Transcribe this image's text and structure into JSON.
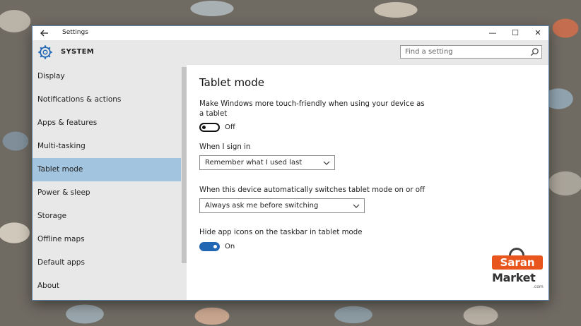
{
  "window": {
    "title": "Settings",
    "back_icon": "back-arrow-icon",
    "controls": {
      "minimize": "—",
      "maximize": "☐",
      "close": "✕"
    }
  },
  "header": {
    "icon": "gear-icon",
    "title": "SYSTEM",
    "search_placeholder": "Find a setting"
  },
  "sidebar": {
    "items": [
      {
        "label": "Display",
        "active": false
      },
      {
        "label": "Notifications & actions",
        "active": false
      },
      {
        "label": "Apps & features",
        "active": false
      },
      {
        "label": "Multi-tasking",
        "active": false
      },
      {
        "label": "Tablet mode",
        "active": true
      },
      {
        "label": "Power & sleep",
        "active": false
      },
      {
        "label": "Storage",
        "active": false
      },
      {
        "label": "Offline maps",
        "active": false
      },
      {
        "label": "Default apps",
        "active": false
      },
      {
        "label": "About",
        "active": false
      }
    ]
  },
  "main": {
    "title": "Tablet mode",
    "touch_friendly": {
      "description": "Make Windows more touch-friendly when using your device as a tablet",
      "state": "Off"
    },
    "sign_in": {
      "label": "When I sign in",
      "selected": "Remember what I used last"
    },
    "auto_switch": {
      "label": "When this device automatically switches tablet mode on or off",
      "selected": "Always ask me before switching"
    },
    "hide_icons": {
      "label": "Hide app icons on the taskbar in tablet mode",
      "state": "On"
    }
  },
  "watermark": {
    "line1": "Saran",
    "line2": "Market",
    "suffix": ".com"
  },
  "colors": {
    "accent": "#2166b3",
    "selected_nav": "#a3c4de",
    "header_bg": "#e8e8e8",
    "logo_orange": "#e8561e"
  }
}
